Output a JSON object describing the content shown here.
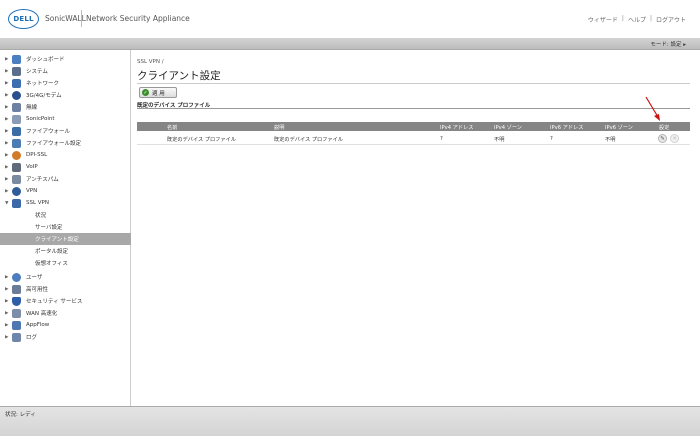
{
  "header": {
    "logo": "DELL",
    "brand": "SonicWALL",
    "product": "Network Security Appliance",
    "links": [
      "ウィザード",
      "ヘルプ",
      "ログアウト"
    ]
  },
  "mode_label": "モード: 設定 ▸",
  "sidebar": {
    "items": [
      {
        "label": "ダッシュボード",
        "icon": "dashboard-icon",
        "color": "#4a7fc1"
      },
      {
        "label": "システム",
        "icon": "system-icon",
        "color": "#5b6e8c"
      },
      {
        "label": "ネットワーク",
        "icon": "network-icon",
        "color": "#3d6fb0"
      },
      {
        "label": "3G/4G/モデム",
        "icon": "modem-icon",
        "color": "#2a4f8f"
      },
      {
        "label": "無線",
        "icon": "wireless-icon",
        "color": "#6d7fa3"
      },
      {
        "label": "SonicPoint",
        "icon": "sonicpoint-icon",
        "color": "#8a9bb5"
      },
      {
        "label": "ファイアウォール",
        "icon": "firewall-icon",
        "color": "#3a6ea5"
      },
      {
        "label": "ファイアウォール設定",
        "icon": "firewall-settings-icon",
        "color": "#4b7cb3"
      },
      {
        "label": "DPI-SSL",
        "icon": "dpi-ssl-icon",
        "color": "#d07b2a"
      },
      {
        "label": "VoIP",
        "icon": "voip-icon",
        "color": "#5f6b7a"
      },
      {
        "label": "アンチスパム",
        "icon": "antispam-icon",
        "color": "#7a8aa0"
      },
      {
        "label": "VPN",
        "icon": "vpn-icon",
        "color": "#2f5d9a"
      },
      {
        "label": "SSL VPN",
        "icon": "ssl-vpn-icon",
        "color": "#3c6aa8"
      }
    ],
    "sub_items": [
      "状況",
      "サーバ設定",
      "クライアント設定",
      "ポータル設定",
      "仮想オフィス"
    ],
    "items_after": [
      {
        "label": "ユーザ",
        "icon": "users-icon",
        "color": "#4d7cc0"
      },
      {
        "label": "高可用性",
        "icon": "high-availability-icon",
        "color": "#6a7c98"
      },
      {
        "label": "セキュリティ サービス",
        "icon": "security-services-icon",
        "color": "#2e5fa8"
      },
      {
        "label": "WAN 高速化",
        "icon": "wan-acceleration-icon",
        "color": "#7d8ea8"
      },
      {
        "label": "AppFlow",
        "icon": "appflow-icon",
        "color": "#4f78b0"
      },
      {
        "label": "ログ",
        "icon": "log-icon",
        "color": "#6f86ab"
      }
    ]
  },
  "main": {
    "breadcrumb": "SSL VPN /",
    "title": "クライアント設定",
    "apply_label": "適 用",
    "section_title": "既定のデバイス プロファイル",
    "table": {
      "headers": [
        "名前",
        "説明",
        "IPv4 アドレス",
        "IPv4 ゾーン",
        "IPv6 アドレス",
        "IPv6 ゾーン",
        "設定"
      ],
      "rows": [
        [
          "既定のデバイス プロファイル",
          "既定のデバイス プロファイル",
          "?",
          "不明",
          "?",
          "不明"
        ]
      ]
    },
    "annotation_color": "#cc1111"
  },
  "status": "状況: レディ"
}
